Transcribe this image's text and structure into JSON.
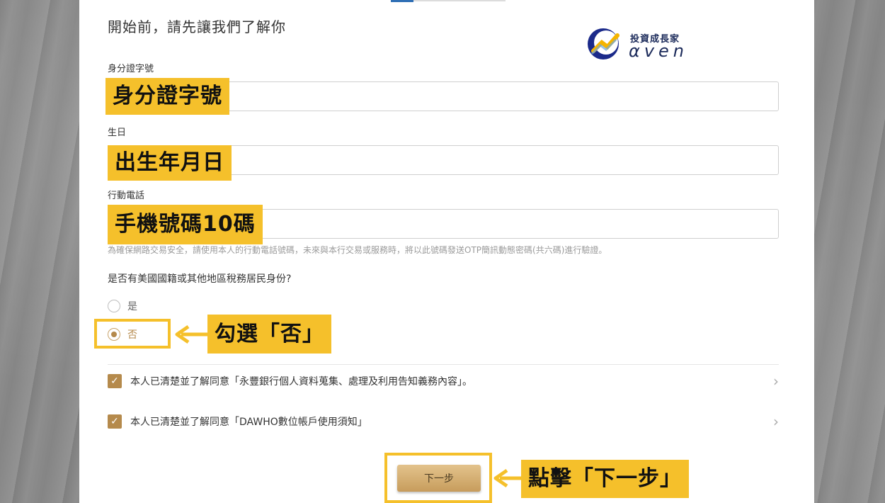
{
  "page": {
    "title": "開始前，請先讓我們了解你"
  },
  "logo": {
    "brand": "投資成長家",
    "word": "αven"
  },
  "fields": {
    "id_label": "身分證字號",
    "birthday_label": "生日",
    "phone_label": "行動電話"
  },
  "annotations": {
    "id": "身分證字號",
    "birthday": "出生年月日",
    "phone": "手機號碼10碼",
    "choose_no": "勾選「否」",
    "click_next": "點擊「下一步」"
  },
  "hint": "為確保網路交易安全，請使用本人的行動電話號碼，未來與本行交易或服務時，將以此號碼發送OTP簡訊動態密碼(共六碼)進行驗證。",
  "tax_question": {
    "text": "是否有美國國籍或其他地區稅務居民身份?",
    "options": [
      "是",
      "否"
    ],
    "selected": "否"
  },
  "agreements": [
    "本人已清楚並了解同意「永豐銀行個人資料蒐集、處理及利用告知義務內容」。",
    "本人已清楚並了解同意「DAWHO數位帳戶使用須知」"
  ],
  "next_button": "下一步",
  "colors": {
    "highlight": "#f5c02b",
    "accent": "#b58a4c"
  }
}
